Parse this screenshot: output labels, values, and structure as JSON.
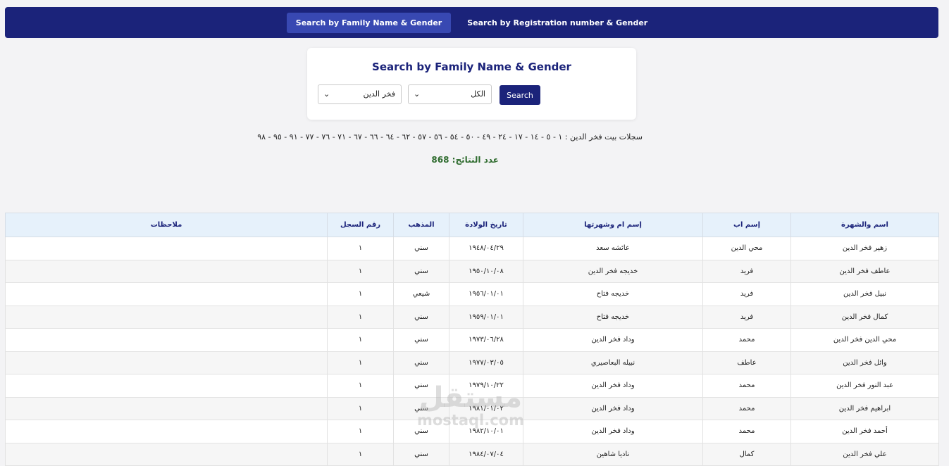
{
  "nav": {
    "tabs": [
      {
        "label": "Search by Family Name & Gender",
        "active": true
      },
      {
        "label": "Search by Registration number & Gender",
        "active": false
      }
    ]
  },
  "search_card": {
    "title": "Search by Family Name & Gender",
    "family_select": "فخر الدين",
    "gender_select": "الكل",
    "search_button": "Search"
  },
  "records_line": "سجلات بيت فخر الدين : ١ - ٥ - ١٤ - ١٧ - ٢٤ - ٤٩ - ٥٠ - ٥٤ - ٥٦ - ٥٧ - ٦٢ - ٦٤ - ٦٦ - ٦٧ - ٧١ - ٧٦ - ٧٧ - ٩١ - ٩٥ - ٩٨",
  "result_count_label": "عدد النتائج: 868",
  "table": {
    "headers": {
      "name": "اسم والشهرة",
      "father": "إسم اب",
      "mother": "إسم ام وشهرتها",
      "birth": "تاريخ الولادة",
      "sect": "المذهب",
      "record": "رقم السجل",
      "notes": "ملاحظات"
    },
    "rows": [
      {
        "name": "زهير فخر الدين",
        "father": "محي الدين",
        "mother": "عائشه سعد",
        "birth": "١٩٤٨/٠٤/٢٩",
        "sect": "سني",
        "record": "١",
        "notes": ""
      },
      {
        "name": "عاطف فخر الدين",
        "father": "فريد",
        "mother": "خديجه فخر الدين",
        "birth": "١٩٥٠/١٠/٠٨",
        "sect": "سني",
        "record": "١",
        "notes": ""
      },
      {
        "name": "نبيل فخر الدين",
        "father": "فريد",
        "mother": "خديجه فتاح",
        "birth": "١٩٥٦/٠١/٠١",
        "sect": "شيعي",
        "record": "١",
        "notes": ""
      },
      {
        "name": "كمال فخر الدين",
        "father": "فريد",
        "mother": "خديجه فتاح",
        "birth": "١٩٥٩/٠١/٠١",
        "sect": "سني",
        "record": "١",
        "notes": ""
      },
      {
        "name": "محي الدين فخر الدين",
        "father": "محمد",
        "mother": "وداد فخر الدين",
        "birth": "١٩٧٣/٠٦/٢٨",
        "sect": "سني",
        "record": "١",
        "notes": ""
      },
      {
        "name": "وائل فخر الدين",
        "father": "عاطف",
        "mother": "نبيله البعاصيري",
        "birth": "١٩٧٧/٠٣/٠٥",
        "sect": "سني",
        "record": "١",
        "notes": ""
      },
      {
        "name": "عبد النور فخر الدين",
        "father": "محمد",
        "mother": "وداد فخر الدين",
        "birth": "١٩٧٩/١٠/٢٢",
        "sect": "سني",
        "record": "١",
        "notes": ""
      },
      {
        "name": "ابراهيم فخر الدين",
        "father": "محمد",
        "mother": "وداد فخر الدين",
        "birth": "١٩٨١/٠١/٠٢",
        "sect": "سني",
        "record": "١",
        "notes": ""
      },
      {
        "name": "أحمد فخر الدين",
        "father": "محمد",
        "mother": "وداد فخر الدين",
        "birth": "١٩٨٢/١٠/٠١",
        "sect": "سني",
        "record": "١",
        "notes": ""
      },
      {
        "name": "علي فخر الدين",
        "father": "كمال",
        "mother": "ناديا شاهين",
        "birth": "١٩٨٤/٠٧/٠٤",
        "sect": "سني",
        "record": "١",
        "notes": ""
      }
    ]
  },
  "watermark": {
    "arabic": "مستقل",
    "latin": "mostaql.com"
  }
}
